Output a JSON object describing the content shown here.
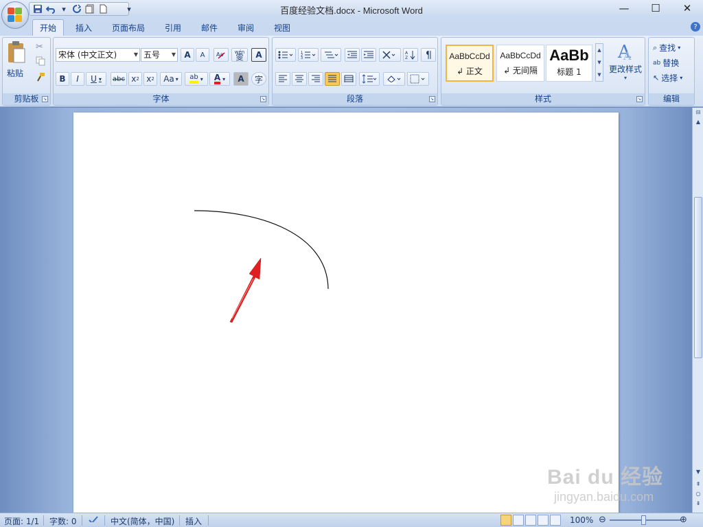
{
  "window": {
    "title": "百度经验文档.docx - Microsoft Word",
    "minimize_label": "—",
    "maximize_label": "☐",
    "close_label": "✕"
  },
  "qat": {
    "save_icon": "save-icon",
    "undo_icon": "undo-icon",
    "redo_icon": "redo-icon",
    "customize_label": "▾"
  },
  "tabs": [
    {
      "label": "开始",
      "active": true
    },
    {
      "label": "插入"
    },
    {
      "label": "页面布局"
    },
    {
      "label": "引用"
    },
    {
      "label": "邮件"
    },
    {
      "label": "审阅"
    },
    {
      "label": "视图"
    }
  ],
  "ribbon": {
    "clipboard": {
      "label": "剪贴板",
      "paste_label": "粘贴"
    },
    "font": {
      "label": "字体",
      "font_name": "宋体 (中文正文)",
      "font_size": "五号",
      "grow_label": "A",
      "shrink_label": "A",
      "pinyin_label": "wén",
      "pinyin_char": "雯",
      "border_char": "A",
      "bold": "B",
      "italic": "I",
      "underline": "U",
      "strike": "abc",
      "subscript": "x",
      "superscript": "x",
      "case": "Aa",
      "highlight": "ab",
      "font_color": "A",
      "shade_char": "A",
      "enclose_char": "字"
    },
    "paragraph": {
      "label": "段落"
    },
    "styles": {
      "label": "样式",
      "tiles": [
        {
          "sample": "AaBbCcDd",
          "name": "↲ 正文"
        },
        {
          "sample": "AaBbCcDd",
          "name": "↲ 无间隔"
        },
        {
          "sample": "AaBb",
          "name": "标题 1"
        }
      ],
      "change_styles": "更改样式"
    },
    "editing": {
      "label": "编辑",
      "find": "查找",
      "replace": "替换",
      "select": "选择"
    }
  },
  "status": {
    "page": "页面: 1/1",
    "words": "字数: 0",
    "language": "中文(简体，中国)",
    "mode": "插入",
    "zoom": "100%"
  },
  "watermark": {
    "main": "Bai du 经验",
    "sub": "jingyan.baidu.com"
  },
  "colors": {
    "arrow": "#e02020",
    "accent": "#15428b"
  }
}
